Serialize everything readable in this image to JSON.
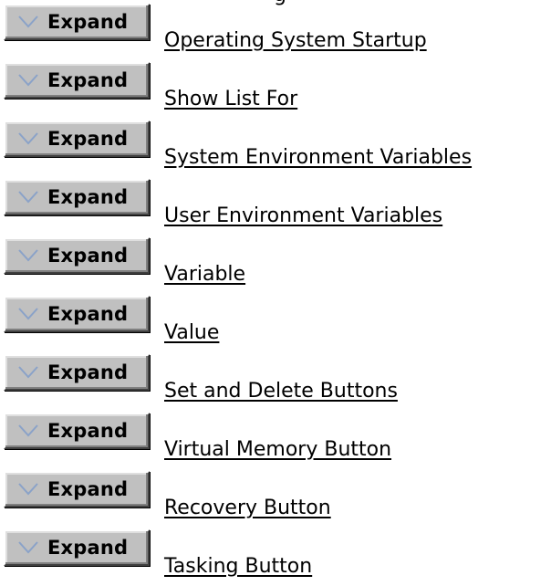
{
  "header": {
    "fragment_text": "g"
  },
  "expand_button": {
    "label": "Expand",
    "icon": "chevron-down-icon"
  },
  "topics": [
    {
      "label": "Operating System Startup"
    },
    {
      "label": "Show List For"
    },
    {
      "label": "System Environment Variables"
    },
    {
      "label": "User Environment Variables"
    },
    {
      "label": "Variable"
    },
    {
      "label": "Value"
    },
    {
      "label": "Set and Delete Buttons"
    },
    {
      "label": "Virtual Memory Button"
    },
    {
      "label": "Recovery Button"
    },
    {
      "label": "Tasking Button"
    }
  ],
  "colors": {
    "button_face": "#c0c0c0",
    "chevron": "#8aa2c8",
    "link_text": "#000000",
    "background": "#ffffff"
  }
}
